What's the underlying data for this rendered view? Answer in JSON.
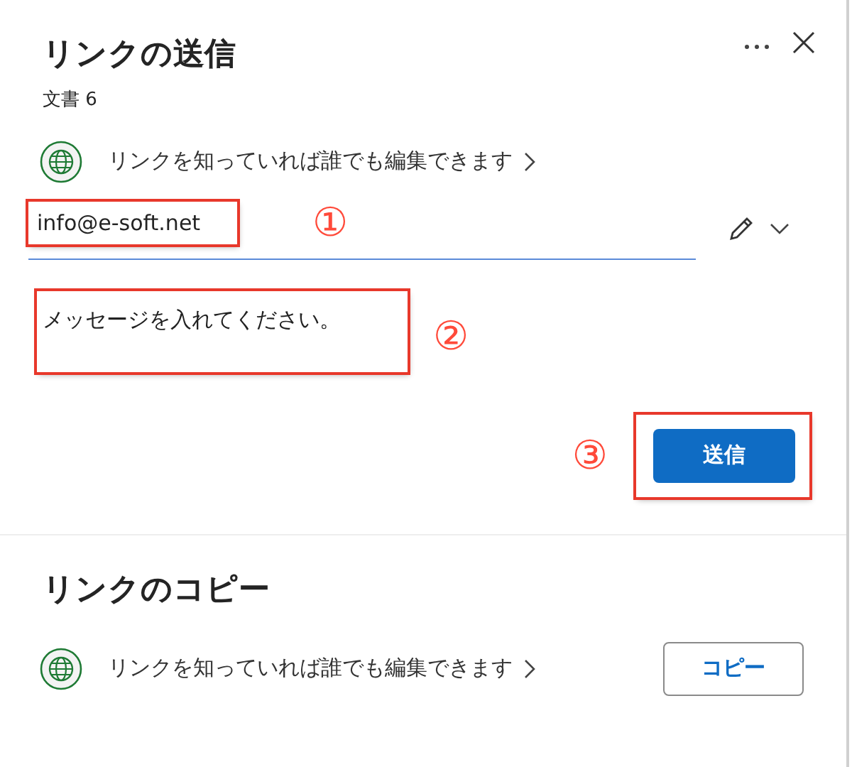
{
  "send_section": {
    "title": "リンクの送信",
    "document": "文書 6",
    "permission": "リンクを知っていれば誰でも編集できます",
    "recipient": {
      "value": "info@e-soft.net",
      "annotation": "①"
    },
    "message": {
      "placeholder": "メッセージを入れてください。",
      "annotation": "②"
    },
    "send_button": {
      "label": "送信",
      "annotation": "③"
    }
  },
  "copy_section": {
    "title": "リンクのコピー",
    "permission": "リンクを知っていれば誰でも編集できます",
    "copy_button": "コピー"
  }
}
